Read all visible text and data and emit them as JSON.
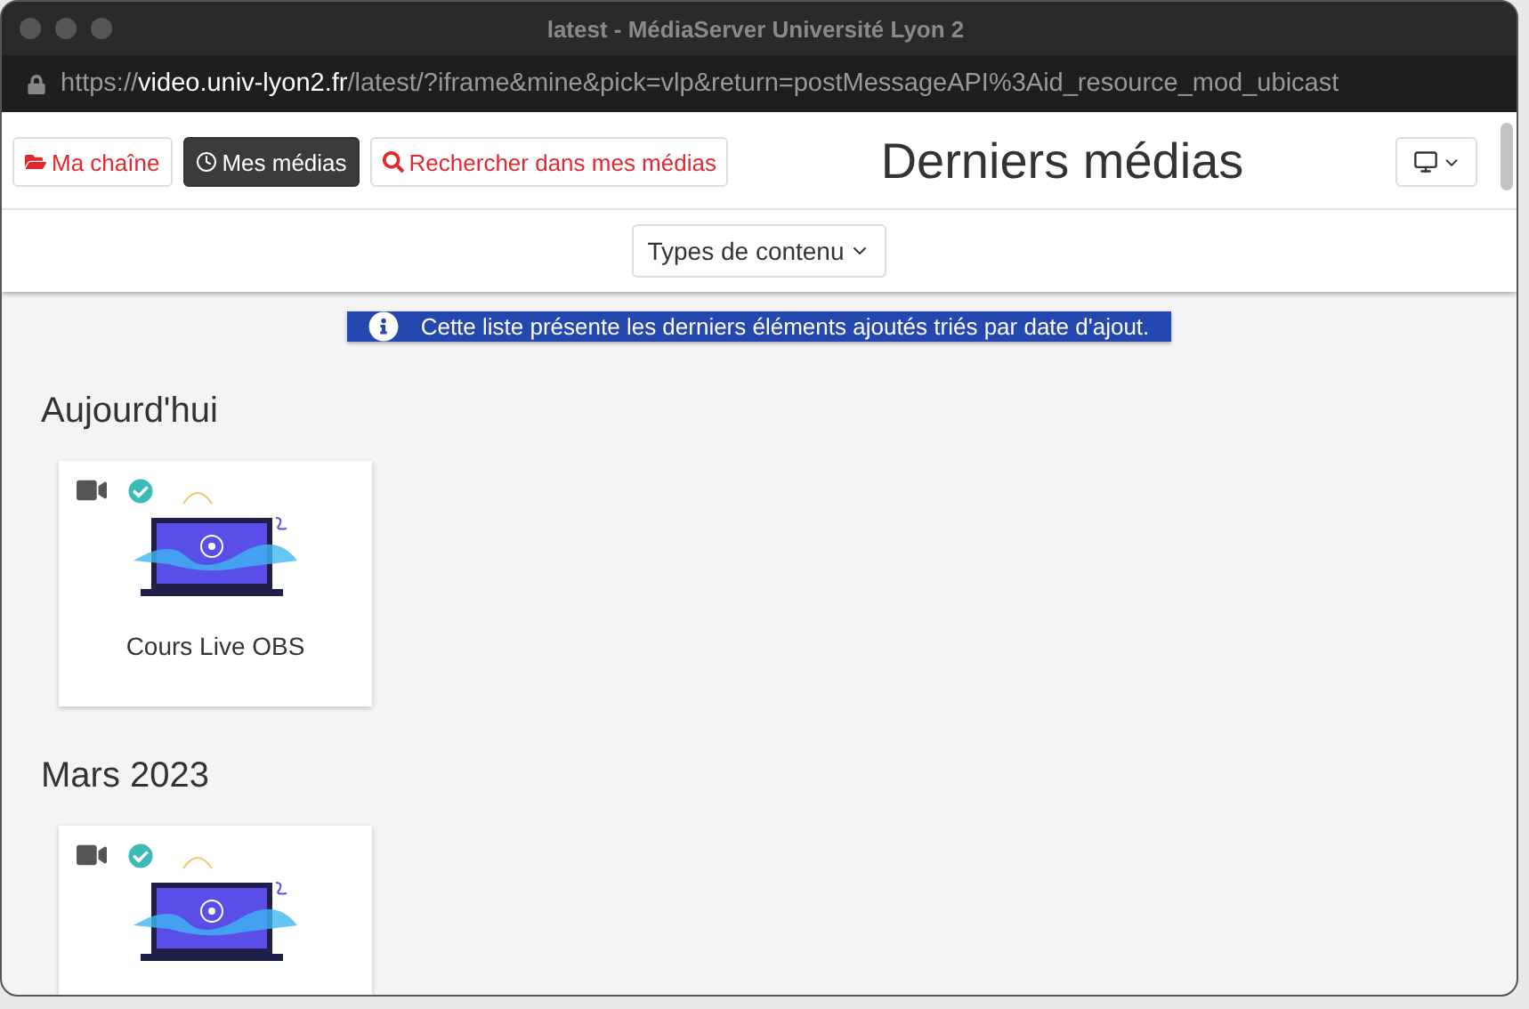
{
  "window": {
    "title": "latest - MédiaServer Université Lyon 2"
  },
  "address_bar": {
    "scheme": "https://",
    "host": "video.univ-lyon2.fr",
    "path": "/latest/?iframe&mine&pick=vlp&return=postMessageAPI%3Aid_resource_mod_ubicast"
  },
  "nav_buttons": [
    {
      "label": "Ma chaîne",
      "selected": false
    },
    {
      "label": "Mes médias",
      "selected": true
    },
    {
      "label": "Rechercher dans mes médias",
      "selected": false
    }
  ],
  "page_title": "Derniers médias",
  "filter": {
    "label": "Types de contenu"
  },
  "info_banner": "Cette liste présente les derniers éléments ajoutés triés par date d'ajout.",
  "sections": [
    {
      "title": "Aujourd'hui",
      "items": [
        {
          "kind": "video",
          "published": true,
          "title": "Cours Live OBS"
        }
      ]
    },
    {
      "title": "Mars 2023",
      "items": [
        {
          "kind": "video",
          "published": true
        }
      ]
    }
  ]
}
